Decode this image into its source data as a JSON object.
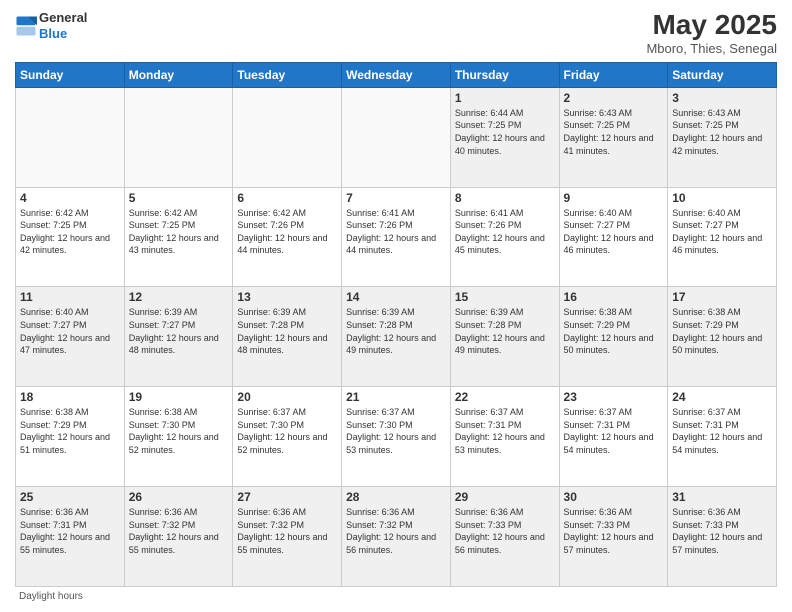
{
  "logo": {
    "text_general": "General",
    "text_blue": "Blue"
  },
  "header": {
    "month_title": "May 2025",
    "subtitle": "Mboro, Thies, Senegal"
  },
  "days_of_week": [
    "Sunday",
    "Monday",
    "Tuesday",
    "Wednesday",
    "Thursday",
    "Friday",
    "Saturday"
  ],
  "footer_text": "Daylight hours",
  "weeks": [
    [
      {
        "day": "",
        "sunrise": "",
        "sunset": "",
        "daylight": "",
        "empty": true
      },
      {
        "day": "",
        "sunrise": "",
        "sunset": "",
        "daylight": "",
        "empty": true
      },
      {
        "day": "",
        "sunrise": "",
        "sunset": "",
        "daylight": "",
        "empty": true
      },
      {
        "day": "",
        "sunrise": "",
        "sunset": "",
        "daylight": "",
        "empty": true
      },
      {
        "day": "1",
        "sunrise": "Sunrise: 6:44 AM",
        "sunset": "Sunset: 7:25 PM",
        "daylight": "Daylight: 12 hours and 40 minutes.",
        "empty": false
      },
      {
        "day": "2",
        "sunrise": "Sunrise: 6:43 AM",
        "sunset": "Sunset: 7:25 PM",
        "daylight": "Daylight: 12 hours and 41 minutes.",
        "empty": false
      },
      {
        "day": "3",
        "sunrise": "Sunrise: 6:43 AM",
        "sunset": "Sunset: 7:25 PM",
        "daylight": "Daylight: 12 hours and 42 minutes.",
        "empty": false
      }
    ],
    [
      {
        "day": "4",
        "sunrise": "Sunrise: 6:42 AM",
        "sunset": "Sunset: 7:25 PM",
        "daylight": "Daylight: 12 hours and 42 minutes.",
        "empty": false
      },
      {
        "day": "5",
        "sunrise": "Sunrise: 6:42 AM",
        "sunset": "Sunset: 7:25 PM",
        "daylight": "Daylight: 12 hours and 43 minutes.",
        "empty": false
      },
      {
        "day": "6",
        "sunrise": "Sunrise: 6:42 AM",
        "sunset": "Sunset: 7:26 PM",
        "daylight": "Daylight: 12 hours and 44 minutes.",
        "empty": false
      },
      {
        "day": "7",
        "sunrise": "Sunrise: 6:41 AM",
        "sunset": "Sunset: 7:26 PM",
        "daylight": "Daylight: 12 hours and 44 minutes.",
        "empty": false
      },
      {
        "day": "8",
        "sunrise": "Sunrise: 6:41 AM",
        "sunset": "Sunset: 7:26 PM",
        "daylight": "Daylight: 12 hours and 45 minutes.",
        "empty": false
      },
      {
        "day": "9",
        "sunrise": "Sunrise: 6:40 AM",
        "sunset": "Sunset: 7:27 PM",
        "daylight": "Daylight: 12 hours and 46 minutes.",
        "empty": false
      },
      {
        "day": "10",
        "sunrise": "Sunrise: 6:40 AM",
        "sunset": "Sunset: 7:27 PM",
        "daylight": "Daylight: 12 hours and 46 minutes.",
        "empty": false
      }
    ],
    [
      {
        "day": "11",
        "sunrise": "Sunrise: 6:40 AM",
        "sunset": "Sunset: 7:27 PM",
        "daylight": "Daylight: 12 hours and 47 minutes.",
        "empty": false
      },
      {
        "day": "12",
        "sunrise": "Sunrise: 6:39 AM",
        "sunset": "Sunset: 7:27 PM",
        "daylight": "Daylight: 12 hours and 48 minutes.",
        "empty": false
      },
      {
        "day": "13",
        "sunrise": "Sunrise: 6:39 AM",
        "sunset": "Sunset: 7:28 PM",
        "daylight": "Daylight: 12 hours and 48 minutes.",
        "empty": false
      },
      {
        "day": "14",
        "sunrise": "Sunrise: 6:39 AM",
        "sunset": "Sunset: 7:28 PM",
        "daylight": "Daylight: 12 hours and 49 minutes.",
        "empty": false
      },
      {
        "day": "15",
        "sunrise": "Sunrise: 6:39 AM",
        "sunset": "Sunset: 7:28 PM",
        "daylight": "Daylight: 12 hours and 49 minutes.",
        "empty": false
      },
      {
        "day": "16",
        "sunrise": "Sunrise: 6:38 AM",
        "sunset": "Sunset: 7:29 PM",
        "daylight": "Daylight: 12 hours and 50 minutes.",
        "empty": false
      },
      {
        "day": "17",
        "sunrise": "Sunrise: 6:38 AM",
        "sunset": "Sunset: 7:29 PM",
        "daylight": "Daylight: 12 hours and 50 minutes.",
        "empty": false
      }
    ],
    [
      {
        "day": "18",
        "sunrise": "Sunrise: 6:38 AM",
        "sunset": "Sunset: 7:29 PM",
        "daylight": "Daylight: 12 hours and 51 minutes.",
        "empty": false
      },
      {
        "day": "19",
        "sunrise": "Sunrise: 6:38 AM",
        "sunset": "Sunset: 7:30 PM",
        "daylight": "Daylight: 12 hours and 52 minutes.",
        "empty": false
      },
      {
        "day": "20",
        "sunrise": "Sunrise: 6:37 AM",
        "sunset": "Sunset: 7:30 PM",
        "daylight": "Daylight: 12 hours and 52 minutes.",
        "empty": false
      },
      {
        "day": "21",
        "sunrise": "Sunrise: 6:37 AM",
        "sunset": "Sunset: 7:30 PM",
        "daylight": "Daylight: 12 hours and 53 minutes.",
        "empty": false
      },
      {
        "day": "22",
        "sunrise": "Sunrise: 6:37 AM",
        "sunset": "Sunset: 7:31 PM",
        "daylight": "Daylight: 12 hours and 53 minutes.",
        "empty": false
      },
      {
        "day": "23",
        "sunrise": "Sunrise: 6:37 AM",
        "sunset": "Sunset: 7:31 PM",
        "daylight": "Daylight: 12 hours and 54 minutes.",
        "empty": false
      },
      {
        "day": "24",
        "sunrise": "Sunrise: 6:37 AM",
        "sunset": "Sunset: 7:31 PM",
        "daylight": "Daylight: 12 hours and 54 minutes.",
        "empty": false
      }
    ],
    [
      {
        "day": "25",
        "sunrise": "Sunrise: 6:36 AM",
        "sunset": "Sunset: 7:31 PM",
        "daylight": "Daylight: 12 hours and 55 minutes.",
        "empty": false
      },
      {
        "day": "26",
        "sunrise": "Sunrise: 6:36 AM",
        "sunset": "Sunset: 7:32 PM",
        "daylight": "Daylight: 12 hours and 55 minutes.",
        "empty": false
      },
      {
        "day": "27",
        "sunrise": "Sunrise: 6:36 AM",
        "sunset": "Sunset: 7:32 PM",
        "daylight": "Daylight: 12 hours and 55 minutes.",
        "empty": false
      },
      {
        "day": "28",
        "sunrise": "Sunrise: 6:36 AM",
        "sunset": "Sunset: 7:32 PM",
        "daylight": "Daylight: 12 hours and 56 minutes.",
        "empty": false
      },
      {
        "day": "29",
        "sunrise": "Sunrise: 6:36 AM",
        "sunset": "Sunset: 7:33 PM",
        "daylight": "Daylight: 12 hours and 56 minutes.",
        "empty": false
      },
      {
        "day": "30",
        "sunrise": "Sunrise: 6:36 AM",
        "sunset": "Sunset: 7:33 PM",
        "daylight": "Daylight: 12 hours and 57 minutes.",
        "empty": false
      },
      {
        "day": "31",
        "sunrise": "Sunrise: 6:36 AM",
        "sunset": "Sunset: 7:33 PM",
        "daylight": "Daylight: 12 hours and 57 minutes.",
        "empty": false
      }
    ]
  ]
}
